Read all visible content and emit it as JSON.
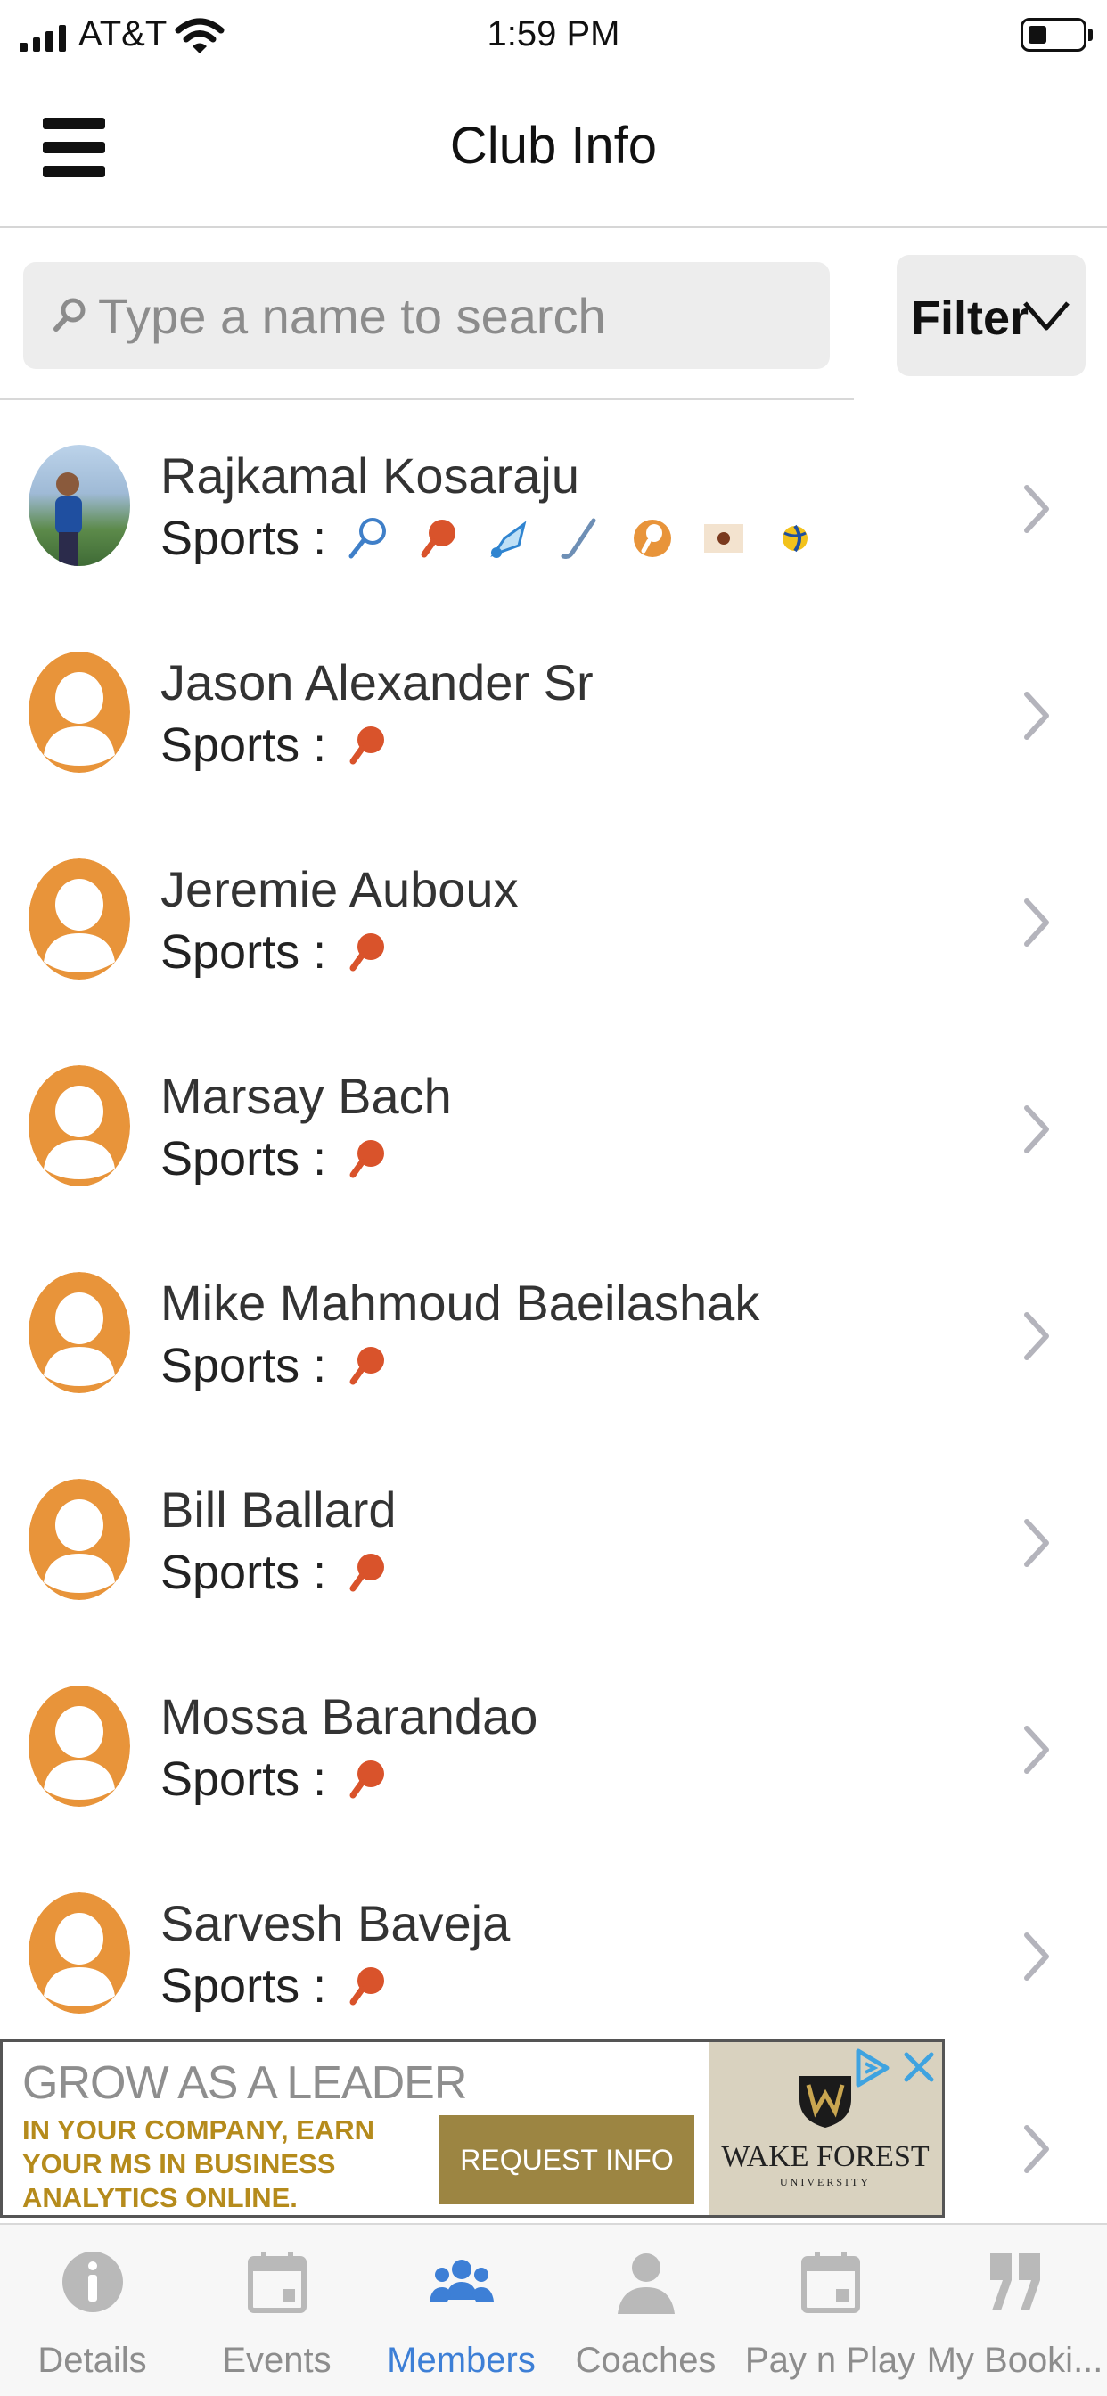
{
  "status_bar": {
    "carrier": "AT&T",
    "time": "1:59 PM"
  },
  "header": {
    "title": "Club Info"
  },
  "search": {
    "placeholder": "Type a name to search"
  },
  "filter": {
    "label": "Filter"
  },
  "members": [
    {
      "name": "Rajkamal Kosaraju",
      "sports_label": "Sports :",
      "avatar": "photo",
      "sports": [
        "tennis-icon",
        "table-tennis-icon",
        "badminton-icon",
        "hockey-stick-icon",
        "squash-icon",
        "cricket-icon",
        "volleyball-icon"
      ]
    },
    {
      "name": "Jason Alexander Sr",
      "sports_label": "Sports :",
      "avatar": "default",
      "sports": [
        "table-tennis-icon"
      ]
    },
    {
      "name": "Jeremie Auboux",
      "sports_label": "Sports :",
      "avatar": "default",
      "sports": [
        "table-tennis-icon"
      ]
    },
    {
      "name": "Marsay Bach",
      "sports_label": "Sports :",
      "avatar": "default",
      "sports": [
        "table-tennis-icon"
      ]
    },
    {
      "name": "Mike Mahmoud Baeilashak",
      "sports_label": "Sports :",
      "avatar": "default",
      "sports": [
        "table-tennis-icon"
      ]
    },
    {
      "name": "Bill Ballard",
      "sports_label": "Sports :",
      "avatar": "default",
      "sports": [
        "table-tennis-icon"
      ]
    },
    {
      "name": "Mossa Barandao",
      "sports_label": "Sports :",
      "avatar": "default",
      "sports": [
        "table-tennis-icon"
      ]
    },
    {
      "name": "Sarvesh Baveja",
      "sports_label": "Sports :",
      "avatar": "default",
      "sports": [
        "table-tennis-icon"
      ]
    }
  ],
  "ad": {
    "headline": "GROW AS A LEADER",
    "body": "IN YOUR COMPANY, EARN YOUR MS IN BUSINESS ANALYTICS ONLINE.",
    "cta": "REQUEST INFO",
    "logo_text": "WAKE FOREST",
    "logo_sub": "UNIVERSITY"
  },
  "tabs": [
    {
      "label": "Details",
      "icon": "info-icon",
      "active": false
    },
    {
      "label": "Events",
      "icon": "calendar-icon",
      "active": false
    },
    {
      "label": "Members",
      "icon": "members-icon",
      "active": true
    },
    {
      "label": "Coaches",
      "icon": "person-icon",
      "active": false
    },
    {
      "label": "Pay n Play",
      "icon": "calendar-icon",
      "active": false
    },
    {
      "label": "My Booki...",
      "icon": "quote-icon",
      "active": false
    }
  ],
  "colors": {
    "accent": "#3d7fd6",
    "avatar_orange": "#e8943a",
    "paddle_red": "#d9532b",
    "tab_inactive": "#8d8d8d",
    "ad_gold": "#b58b1c"
  }
}
